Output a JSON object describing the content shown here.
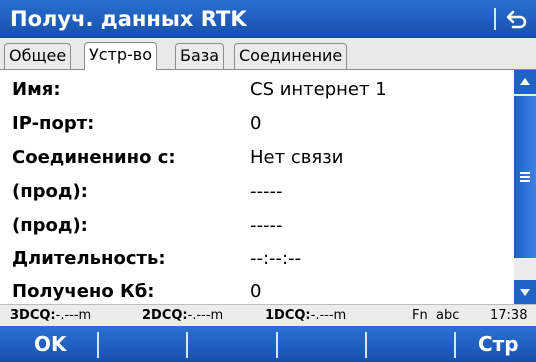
{
  "window": {
    "title": "Получ. данных RTK",
    "back_icon": "return-arrow-icon"
  },
  "tabs": [
    {
      "label": "Общее",
      "active": false
    },
    {
      "label": "Устр-во",
      "active": true
    },
    {
      "label": "База",
      "active": false
    },
    {
      "label": "Соединение",
      "active": false
    }
  ],
  "fields": [
    {
      "label": "Имя:",
      "value": "CS интернет 1"
    },
    {
      "label": "IP-порт:",
      "value": "0"
    },
    {
      "label": "Соединенино с:",
      "value": "Нет связи"
    },
    {
      "label": "(прод):",
      "value": "-----"
    },
    {
      "label": "(прод):",
      "value": "-----"
    },
    {
      "label": "Длительность:",
      "value": "--:--:--"
    },
    {
      "label": "Получено Кб:",
      "value": "0"
    }
  ],
  "status": {
    "q3_label": "3DCQ:",
    "q3_value": "-.---m",
    "q2_label": "2DCQ:",
    "q2_value": "-.---m",
    "q1_label": "1DCQ:",
    "q1_value": "-.---m",
    "mode": "Fn  abc",
    "time": "17:38"
  },
  "softkeys": {
    "left": "OK",
    "right": "Стр"
  },
  "colors": {
    "accent": "#1e5fc4",
    "status_bg": "#ececec"
  }
}
